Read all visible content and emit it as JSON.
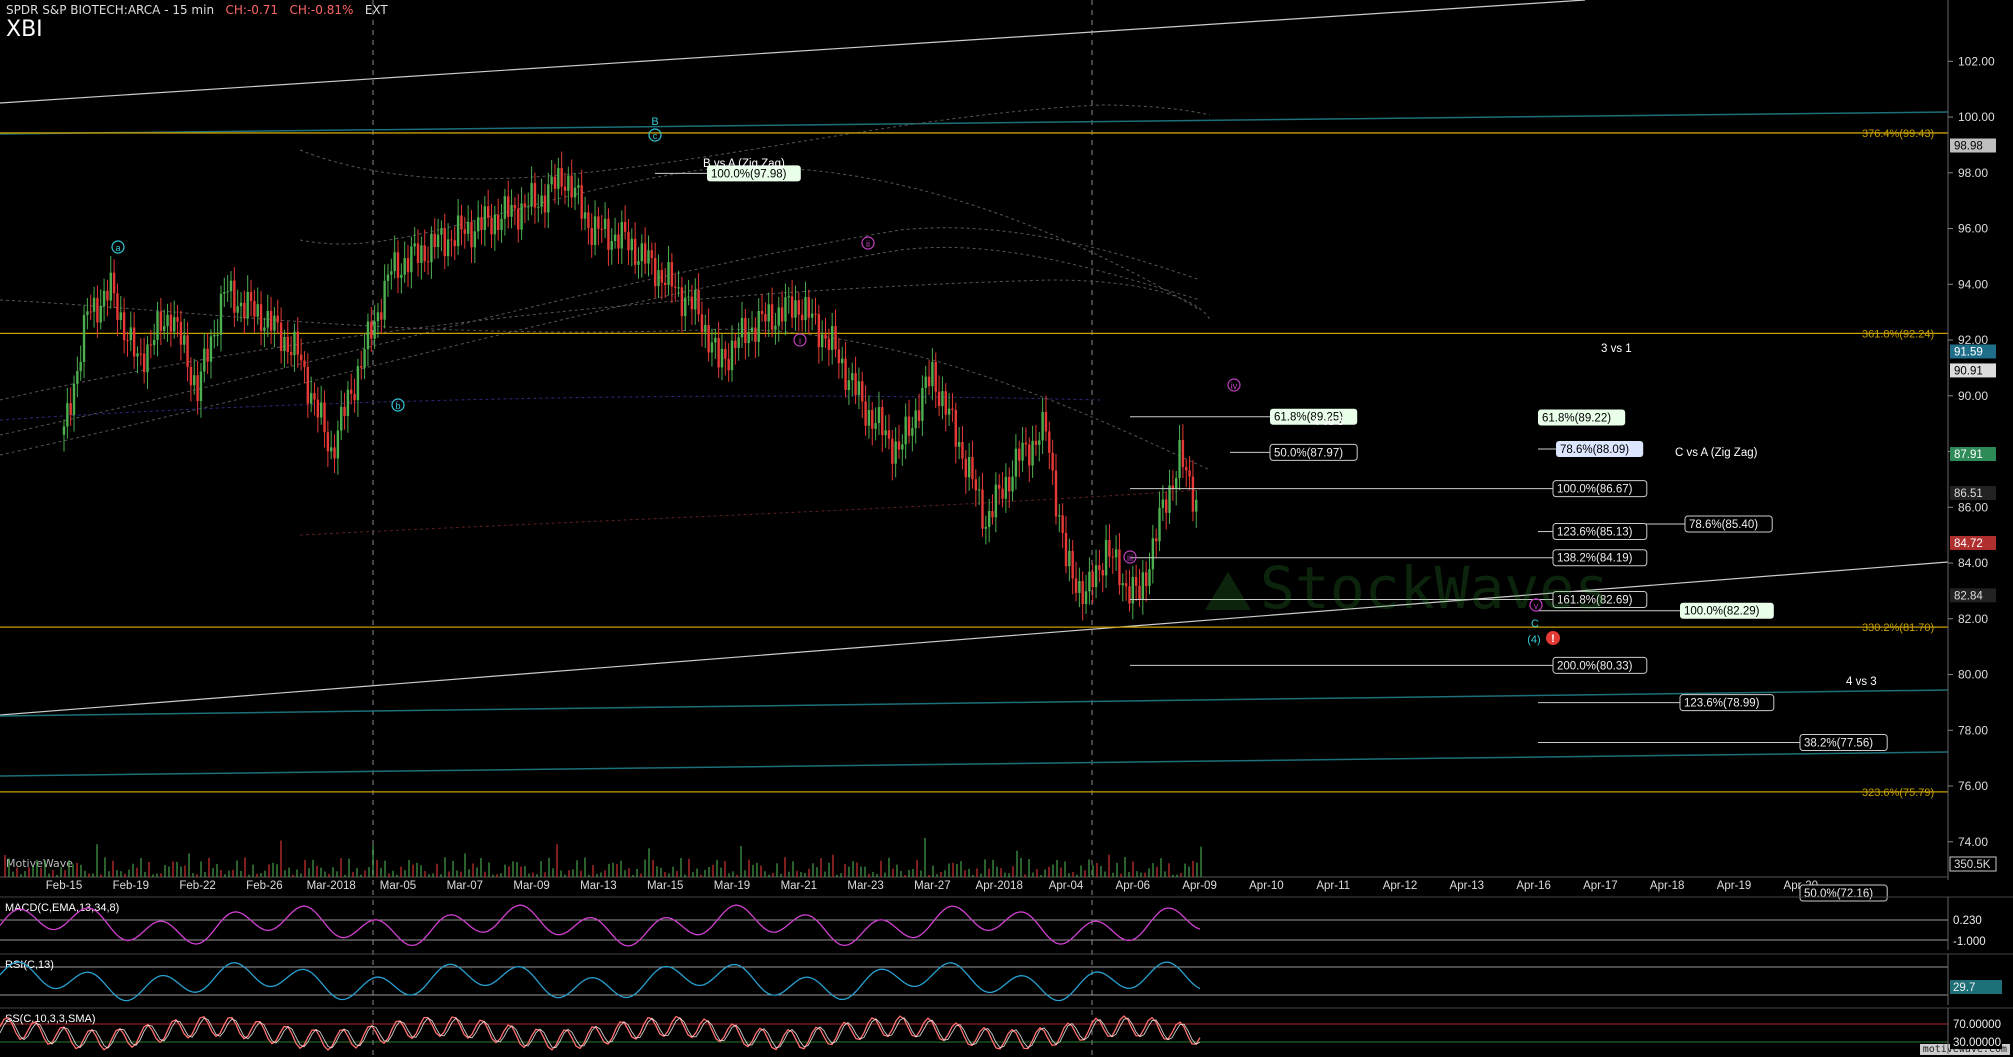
{
  "header": {
    "title": "SPDR S&P BIOTECH:ARCA - 15 min",
    "change_abs": "CH:-0.71",
    "change_pct": "CH:-0.81%",
    "session": "EXT",
    "symbol": "XBI"
  },
  "watermark": {
    "credit": "MotiveWave",
    "site": "motivewave.com",
    "logo": "StockWaves"
  },
  "colors": {
    "up": "#4caf50",
    "down": "#e53935",
    "fib": "#c8a000",
    "teal": "#1d6f78",
    "macd": "#d040d0",
    "rsi": "#29a0d0",
    "stoch_k": "#ff7070",
    "stoch_d": "#ffffff"
  },
  "chart_data": {
    "type": "line",
    "title": "SPDR S&P BIOTECH:ARCA - 15 min",
    "ylim": [
      72.7,
      104.2
    ],
    "y_ticks": [
      "102.00",
      "100.00",
      "98.00",
      "96.00",
      "94.00",
      "92.00",
      "90.00",
      "88.00",
      "86.00",
      "84.00",
      "82.00",
      "80.00",
      "78.00",
      "76.00",
      "74.00"
    ],
    "x_ticks": [
      "Feb-15",
      "Feb-19",
      "Feb-22",
      "Feb-26",
      "Mar-2018",
      "Mar-05",
      "Mar-07",
      "Mar-09",
      "Mar-13",
      "Mar-15",
      "Mar-19",
      "Mar-21",
      "Mar-23",
      "Mar-27",
      "Apr-2018",
      "Apr-04",
      "Apr-06",
      "Apr-09",
      "Apr-10",
      "Apr-11",
      "Apr-12",
      "Apr-13",
      "Apr-16",
      "Apr-17",
      "Apr-18",
      "Apr-19",
      "Apr-20"
    ],
    "price_path": [
      [
        0,
        88.6
      ],
      [
        0.35,
        92.9
      ],
      [
        0.7,
        93.8
      ],
      [
        1.1,
        91.2
      ],
      [
        1.6,
        93.0
      ],
      [
        2.0,
        90.2
      ],
      [
        2.4,
        93.7
      ],
      [
        3.0,
        92.8
      ],
      [
        3.5,
        91.5
      ],
      [
        4.0,
        88.0
      ],
      [
        4.35,
        90.5
      ],
      [
        4.9,
        94.5
      ],
      [
        5.6,
        95.5
      ],
      [
        6.4,
        96.3
      ],
      [
        7.1,
        97.0
      ],
      [
        7.5,
        97.9
      ],
      [
        7.9,
        96.0
      ],
      [
        8.4,
        95.6
      ],
      [
        9.0,
        94.2
      ],
      [
        9.5,
        93.0
      ],
      [
        9.8,
        91.2
      ],
      [
        10.3,
        92.5
      ],
      [
        11.0,
        93.3
      ],
      [
        11.5,
        91.8
      ],
      [
        12.0,
        89.5
      ],
      [
        12.5,
        88.0
      ],
      [
        13.0,
        90.8
      ],
      [
        13.4,
        88.3
      ],
      [
        13.8,
        85.5
      ],
      [
        14.3,
        87.8
      ],
      [
        14.7,
        88.8
      ],
      [
        15.0,
        84.0
      ],
      [
        15.3,
        82.8
      ],
      [
        15.6,
        84.5
      ],
      [
        15.9,
        83.2
      ],
      [
        16.1,
        82.8
      ],
      [
        16.4,
        85.5
      ],
      [
        16.7,
        87.8
      ],
      [
        16.85,
        86.8
      ],
      [
        16.95,
        86.3
      ]
    ],
    "volume_label": "350.5K",
    "price_axis_markers": [
      {
        "label": "98.98",
        "value": 98.98,
        "bg": "#bfbfbf",
        "fg": "#000"
      },
      {
        "label": "91.59",
        "value": 91.59,
        "bg": "#1f6f8b",
        "fg": "#fff"
      },
      {
        "label": "90.91",
        "value": 90.91,
        "bg": "#dcdcdc",
        "fg": "#000"
      },
      {
        "label": "87.91",
        "value": 87.91,
        "bg": "#2e8b57",
        "fg": "#fff"
      },
      {
        "label": "86.51",
        "value": 86.51,
        "bg": "#222",
        "fg": "#ddd"
      },
      {
        "label": "84.72",
        "value": 84.72,
        "bg": "#b03030",
        "fg": "#fff"
      },
      {
        "label": "82.84",
        "value": 82.84,
        "bg": "#222",
        "fg": "#ddd"
      }
    ],
    "fib_levels": [
      {
        "label": "376.4%(99.43)",
        "value": 99.43
      },
      {
        "label": "361.8%(92.24)",
        "value": 92.24
      },
      {
        "label": "330.2%(81.70)",
        "value": 81.7
      },
      {
        "label": "323.6%(75.79)",
        "value": 75.79
      }
    ],
    "projections": [
      {
        "label": "61.8%(89.25)",
        "value": 89.25,
        "style": "green"
      },
      {
        "label": "50.0%(87.97)",
        "value": 87.97,
        "style": "dark"
      },
      {
        "label": "61.8%(89.22)",
        "value": 89.22,
        "style": "green"
      },
      {
        "label": "78.6%(88.09)",
        "value": 88.09,
        "style": "blue"
      },
      {
        "label": "100.0%(86.67)",
        "value": 86.67,
        "style": "dark"
      },
      {
        "label": "78.6%(85.40)",
        "value": 85.4,
        "style": "dark"
      },
      {
        "label": "123.6%(85.13)",
        "value": 85.13,
        "style": "dark"
      },
      {
        "label": "138.2%(84.19)",
        "value": 84.19,
        "style": "dark"
      },
      {
        "label": "161.8%(82.69)",
        "value": 82.69,
        "style": "dark"
      },
      {
        "label": "100.0%(82.29)",
        "value": 82.29,
        "style": "green"
      },
      {
        "label": "200.0%(80.33)",
        "value": 80.33,
        "style": "dark"
      },
      {
        "label": "123.6%(78.99)",
        "value": 78.99,
        "style": "dark"
      },
      {
        "label": "38.2%(77.56)",
        "value": 77.56,
        "style": "dark"
      },
      {
        "label": "100.0%(97.98)",
        "value": 97.98,
        "style": "green"
      },
      {
        "label": "50.0%(72.16)",
        "value": 72.16,
        "style": "dark"
      }
    ],
    "annotations": [
      "B vs A (Zig Zag)",
      "3 vs 1",
      "4 vs 3",
      "C vs A (Zig Zag)",
      "4 vs 3"
    ],
    "wave_labels": [
      "B",
      "c",
      "a",
      "b",
      "ii",
      "i",
      "iii",
      "iv",
      "v",
      "C",
      "(4)",
      "!"
    ],
    "indicators": [
      {
        "name": "MACD(C,EMA,13,34,8)",
        "labels": [
          "0.230",
          "-1.000"
        ]
      },
      {
        "name": "RSI(C,13)",
        "labels": [
          "29.7"
        ]
      },
      {
        "name": "SS(C,10,3,3,SMA)",
        "labels": [
          "70.00000",
          "30.00000"
        ]
      }
    ]
  }
}
